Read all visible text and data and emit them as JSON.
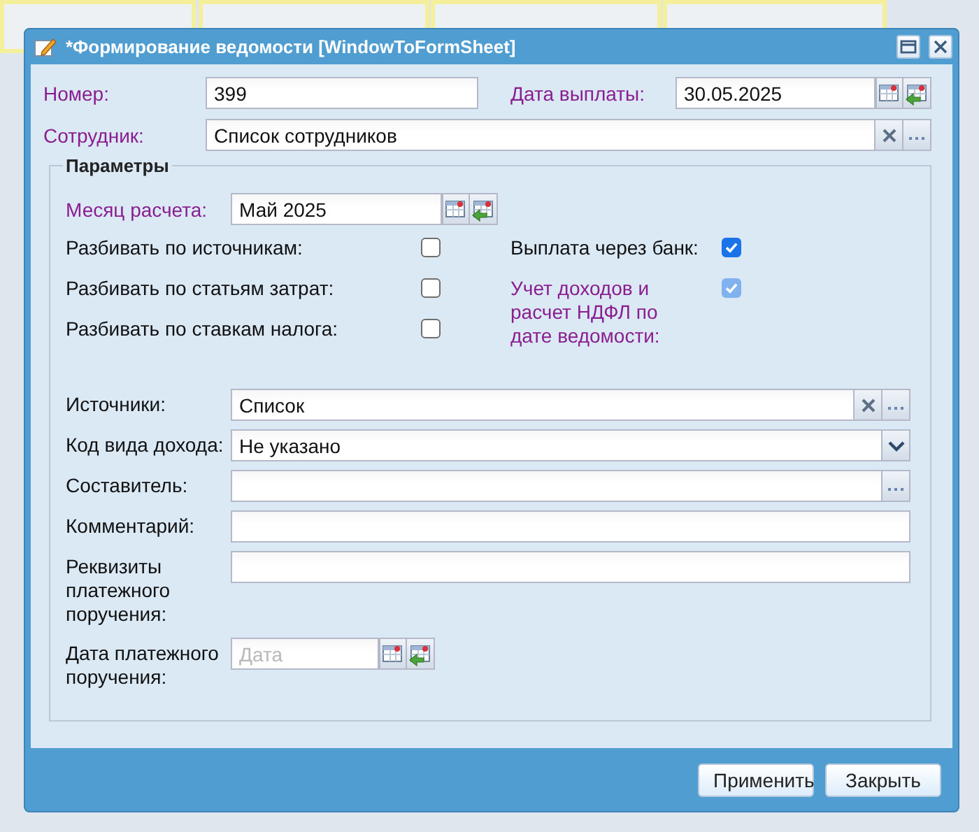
{
  "window": {
    "title": "*Формирование ведомости [WindowToFormSheet]"
  },
  "header_fields": [
    {
      "label": "Номер:",
      "value": "399",
      "kind": "text",
      "required": true
    },
    {
      "label": "Дата выплаты:",
      "value": "30.05.2025",
      "kind": "date",
      "required": true
    }
  ],
  "employee": {
    "label": "Сотрудник:",
    "value": "Список сотрудников",
    "kind": "lookup",
    "required": true
  },
  "parameters": {
    "title": "Параметры",
    "month": {
      "label": "Месяц расчета:",
      "value": "Май 2025",
      "kind": "date",
      "required": true
    },
    "checkboxes_left": [
      {
        "label": "Разбивать по источникам:",
        "checked": false,
        "disabled": false,
        "required": false
      },
      {
        "label": "Разбивать по статьям затрат:",
        "checked": false,
        "disabled": false,
        "required": false
      },
      {
        "label": "Разбивать по ставкам налога:",
        "checked": false,
        "disabled": false,
        "required": false
      }
    ],
    "checkboxes_right": [
      {
        "label": "Выплата через банк:",
        "checked": true,
        "disabled": false,
        "required": false
      },
      {
        "label": "Учет доходов и расчет НДФЛ по дате ведомости:",
        "checked": true,
        "disabled": true,
        "required": true
      }
    ],
    "fields": [
      {
        "label": "Источники:",
        "value": "Список",
        "kind": "lookup",
        "required": false
      },
      {
        "label": "Код вида дохода:",
        "value": "Не указано",
        "kind": "combo",
        "required": false
      },
      {
        "label": "Составитель:",
        "kind": "picker",
        "required": false
      },
      {
        "label": "Комментарий:",
        "kind": "text",
        "required": false
      },
      {
        "label": "Реквизиты платежного поручения:",
        "kind": "text",
        "required": false
      },
      {
        "label": "Дата платежного поручения:",
        "placeholder": "Дата",
        "kind": "date",
        "required": false
      }
    ]
  },
  "buttons": [
    "Применить",
    "Закрыть"
  ]
}
